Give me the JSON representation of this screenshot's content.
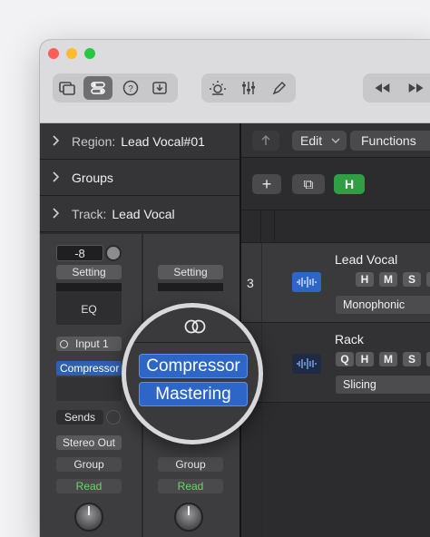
{
  "toolbar": {
    "icons": [
      "library-icon",
      "inspector-icon",
      "quick-help-icon",
      "download-icon",
      "metronome-icon",
      "mixer-sliders-icon",
      "pencil-icon",
      "rewind-icon",
      "fast-forward-icon"
    ]
  },
  "inspector": {
    "region_label": "Region:",
    "region_name": "Lead Vocal#01",
    "groups_label": "Groups",
    "track_label": "Track:",
    "track_name": "Lead Vocal"
  },
  "channel_strip_1": {
    "gain": "-8",
    "setting": "Setting",
    "eq": "EQ",
    "input": "Input 1",
    "plugin": "Compressor",
    "sends": "Sends",
    "output": "Stereo Out",
    "group": "Group",
    "automation": "Read"
  },
  "channel_strip_2": {
    "setting": "Setting",
    "group": "Group",
    "automation": "Read"
  },
  "magnifier": {
    "plugin_1": "Compressor",
    "plugin_2": "Mastering"
  },
  "tracks_header": {
    "edit": "Edit",
    "functions": "Functions",
    "add": "+",
    "duplicate": "⧉",
    "hide": "H"
  },
  "tracks": [
    {
      "number": "3",
      "name": "Lead Vocal",
      "buttons": [
        "H",
        "M",
        "S"
      ],
      "mode": "Monophonic"
    },
    {
      "number": "",
      "name": "Rack",
      "buttons": [
        "Q",
        "H",
        "M",
        "S"
      ],
      "mode": "Slicing"
    }
  ],
  "colors": {
    "accent_blue": "#2e66c8",
    "green_button": "#2f9e44",
    "read_green": "#6bd36b"
  }
}
